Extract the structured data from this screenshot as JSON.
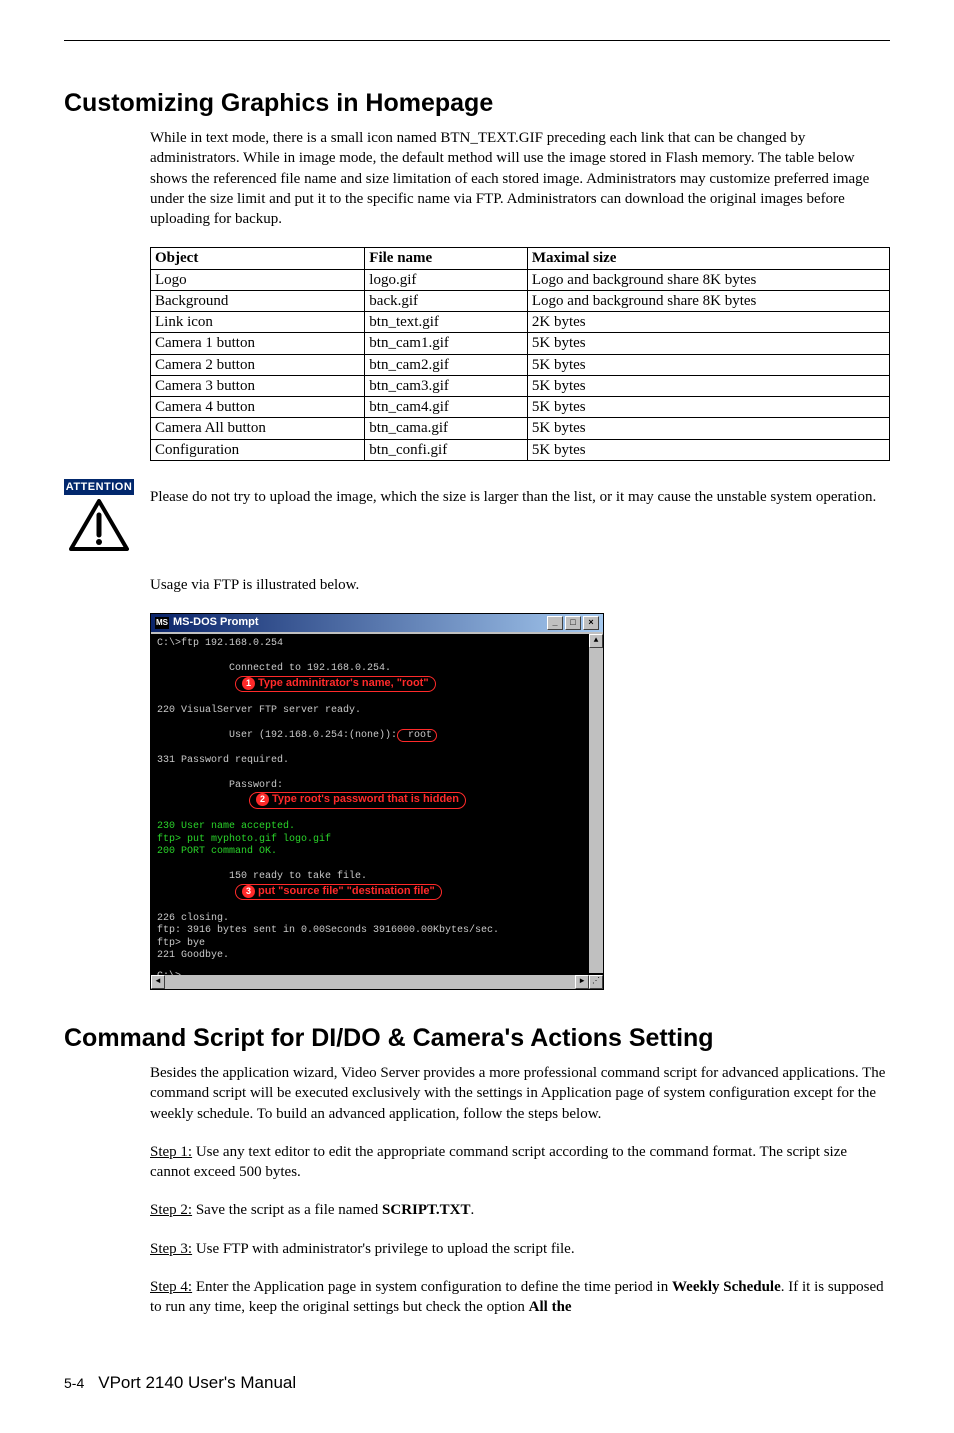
{
  "headings": {
    "h1": "Customizing Graphics in Homepage",
    "h2": "Command Script for DI/DO & Camera's Actions Setting"
  },
  "paragraphs": {
    "p1": "While in text mode, there is a small icon named BTN_TEXT.GIF preceding each link that can be changed by administrators. While in image mode, the default method will use the image stored in Flash memory. The table below shows the referenced file name and size limitation of each stored image. Administrators may customize preferred image under the size limit and put it to the specific name via FTP. Administrators can download the original images before uploading for backup.",
    "attention": "Please do not try to upload the image, which the size is larger than the list, or it may cause the unstable system operation.",
    "usage": "Usage via FTP is illustrated below.",
    "p2": "Besides the application wizard, Video Server provides a more professional command script for advanced applications. The command script will be executed exclusively with the settings in Application page of system configuration except for the weekly schedule. To build an advanced application, follow the steps below.",
    "step1_label": "Step 1:",
    "step1_text": " Use any text editor to edit the appropriate command script according to the command format. The script size cannot exceed 500 bytes.",
    "step2_label": "Step 2:",
    "step2_text_a": " Save the script as a file named ",
    "step2_bold": "SCRIPT.TXT",
    "step2_text_b": ".",
    "step3_label": "Step 3:",
    "step3_text": " Use FTP with administrator's privilege to upload the script file.",
    "step4_label": "Step 4:",
    "step4_text_a": " Enter the Application page in system configuration to define the time period in ",
    "step4_bold_a": "Weekly Schedule",
    "step4_text_b": ". If it is supposed to run any time, keep the original settings but check the option ",
    "step4_bold_b": "All the"
  },
  "attention_label": "ATTENTION",
  "table": {
    "headers": {
      "object": "Object",
      "file": "File name",
      "max": "Maximal size"
    },
    "rows": [
      {
        "object": "Logo",
        "file": "logo.gif",
        "max": "Logo and background share 8K bytes"
      },
      {
        "object": "Background",
        "file": "back.gif",
        "max": "Logo and background share 8K bytes"
      },
      {
        "object": "Link icon",
        "file": "btn_text.gif",
        "max": "2K bytes"
      },
      {
        "object": "Camera 1 button",
        "file": "btn_cam1.gif",
        "max": "5K bytes"
      },
      {
        "object": "Camera 2 button",
        "file": "btn_cam2.gif",
        "max": "5K bytes"
      },
      {
        "object": "Camera 3 button",
        "file": "btn_cam3.gif",
        "max": "5K bytes"
      },
      {
        "object": "Camera 4 button",
        "file": "btn_cam4.gif",
        "max": "5K bytes"
      },
      {
        "object": "Camera All button",
        "file": "btn_cama.gif",
        "max": "5K bytes"
      },
      {
        "object": "Configuration",
        "file": "btn_confi.gif",
        "max": "5K bytes"
      }
    ]
  },
  "dos": {
    "title": "MS-DOS Prompt",
    "sysicon": "MS",
    "lines": {
      "l1": "C:\\>ftp 192.168.0.254",
      "l2": "Connected to 192.168.0.254.",
      "l3": "220 VisualServer FTP server ready.",
      "l4a": "User (192.168.0.254:(none)):",
      "l4b": " root",
      "l5": "331 Password required.",
      "l6": "Password:",
      "l7": "230 User name accepted.",
      "l8": "ftp> put myphoto.gif logo.gif",
      "l9": "200 PORT command OK.",
      "l10": "150 ready to take file.",
      "l11": "226 closing.",
      "l12": "ftp: 3916 bytes sent in 0.00Seconds 3916000.00Kbytes/sec.",
      "l13": "ftp> bye",
      "l14": "221 Goodbye.",
      "l15": "C:\\>"
    },
    "annot": {
      "a1": "Type adminitrator's name, \"root\"",
      "a2": "Type root's password that is hidden",
      "a3": "put \"source file\" \"destination file\"",
      "n1": "1",
      "n2": "2",
      "n3": "3"
    }
  },
  "footer": {
    "page": "5-4",
    "manual": "VPort 2140 User's Manual"
  }
}
